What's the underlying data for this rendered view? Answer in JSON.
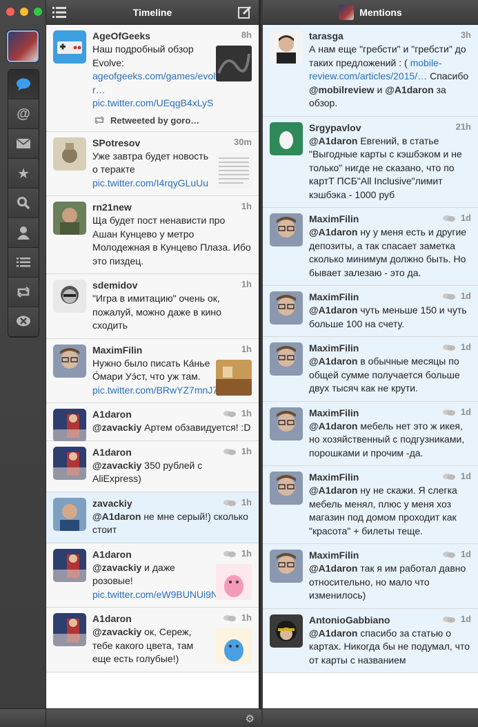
{
  "colors": {
    "accent": "#2a6fb7",
    "close": "#fc5f57",
    "minimize": "#fdbc2e",
    "zoom": "#33c748",
    "highlight": "#e6f2fb"
  },
  "rail": {
    "account_icon": "user-avatar",
    "buttons": [
      {
        "icon": "speech-bubble-icon",
        "active": true
      },
      {
        "icon": "at-icon"
      },
      {
        "icon": "envelope-icon"
      },
      {
        "icon": "star-icon"
      },
      {
        "icon": "search-icon"
      },
      {
        "icon": "user-icon"
      },
      {
        "icon": "list-icon"
      },
      {
        "icon": "retweet-icon"
      },
      {
        "icon": "mute-icon"
      }
    ]
  },
  "timeline": {
    "title": "Timeline",
    "tweets": [
      {
        "name": "AgeOfGeeks",
        "time": "8h",
        "text": "Наш подробный обзор Evolve:",
        "links": [
          "ageofgeeks.com/games/evolve-r…",
          "pic.twitter.com/UEqgB4xLyS"
        ],
        "retweeted_by": "Retweeted by goro…",
        "avatar": "gamepad",
        "thumb": "dark"
      },
      {
        "name": "SPotresov",
        "time": "30m",
        "text": "Уже завтра будет новость о теракте",
        "links": [
          "pic.twitter.com/I4rqyGLuUu"
        ],
        "avatar": "sepia",
        "thumb": "paper"
      },
      {
        "name": "rn21new",
        "time": "1h",
        "text": "Ща будет пост ненависти про Ашан Кунцево у метро Молодежная в Кунцево Плаза. Ибо это пиздец.",
        "avatar": "man-drink"
      },
      {
        "name": "sdemidov",
        "time": "1h",
        "text": "\"Игра в имитацию\" очень ок, пожалуй, можно даже в кино сходить",
        "avatar": "bw-man"
      },
      {
        "name": "MaximFilin",
        "time": "1h",
        "text": "Нужно было писать Ка́нье О́мари Уэ́ст, что уж там.",
        "links": [
          "pic.twitter.com/BRwYZ7mnJ7"
        ],
        "avatar": "glasses",
        "thumb": "room"
      },
      {
        "name": "A1daron",
        "time": "1h",
        "conv": true,
        "mention": "@zavackiy",
        "text": " Артем обзавидуется! :D",
        "avatar": "a1daron"
      },
      {
        "name": "A1daron",
        "time": "1h",
        "conv": true,
        "mention": "@zavackiy",
        "text": " 350 рублей с AliExpress)",
        "avatar": "a1daron"
      },
      {
        "name": "zavackiy",
        "time": "1h",
        "conv": true,
        "mention": "@A1daron",
        "text": " не мне серый!) сколько стоит",
        "avatar": "blue-man",
        "highlight": true
      },
      {
        "name": "A1daron",
        "time": "1h",
        "conv": true,
        "mention": "@zavackiy",
        "text": " и даже розовые!",
        "links": [
          "pic.twitter.com/eW9BUNUi9N"
        ],
        "avatar": "a1daron",
        "thumb": "pink-toy"
      },
      {
        "name": "A1daron",
        "time": "1h",
        "conv": true,
        "mention": "@zavackiy",
        "text": " ок, Сереж, тебе какого цвета, там еще есть голубые!)",
        "avatar": "a1daron",
        "thumb": "blue-toy"
      }
    ]
  },
  "mentions": {
    "title": "Mentions",
    "tweets": [
      {
        "name": "tarasga",
        "time": "3h",
        "html": "А нам еще \"гребсти\" и \"гребсти\" до таких предложений : ( <a>mobile-review.com/articles/2015/…</a> Спасибо <b>@mobilreview</b> и <b>@A1daron</b> за обзор.",
        "avatar": "white-man"
      },
      {
        "name": "Srgypavlov",
        "time": "21h",
        "html": "<b>@A1daron</b> Евгений, в статье \"Выгодные карты с кэшбэком и не только\" нигде не сказано, что по картТ ПСБ\"All Inclusive\"лимит кэшбэка - 1000 руб",
        "avatar": "egg"
      },
      {
        "name": "MaximFilin",
        "time": "1d",
        "conv": true,
        "html": "<b>@A1daron</b> ну у меня есть и другие депозиты, а так спасает заметка сколько минимум должно быть. Но бывает залезаю - это да.",
        "avatar": "glasses"
      },
      {
        "name": "MaximFilin",
        "time": "1d",
        "conv": true,
        "html": "<b>@A1daron</b> чуть меньше 150 и чуть больше 100 на счету.",
        "avatar": "glasses"
      },
      {
        "name": "MaximFilin",
        "time": "1d",
        "conv": true,
        "html": "<b>@A1daron</b> в обычные месяцы по общей сумме получается больше двух тысяч как не крути.",
        "avatar": "glasses"
      },
      {
        "name": "MaximFilin",
        "time": "1d",
        "conv": true,
        "html": "<b>@A1daron</b> мебель нет это ж икея, но хозяйственный с подгузниками, порошками и прочим -да.",
        "avatar": "glasses"
      },
      {
        "name": "MaximFilin",
        "time": "1d",
        "conv": true,
        "html": "<b>@A1daron</b> ну не скажи. Я слегка мебель менял, плюс у меня хоз магазин под домом проходит как \"красота\" + билеты теще.",
        "avatar": "glasses"
      },
      {
        "name": "MaximFilin",
        "time": "1d",
        "conv": true,
        "html": "<b>@A1daron</b> так я им работал давно относительно, но мало что изменилось)",
        "avatar": "glasses"
      },
      {
        "name": "AntonioGabbiano",
        "time": "1d",
        "conv": true,
        "html": "<b>@A1daron</b> спасибо за статью о картах. Никогда бы не подумал, что от карты с названием",
        "avatar": "helmet"
      }
    ]
  }
}
